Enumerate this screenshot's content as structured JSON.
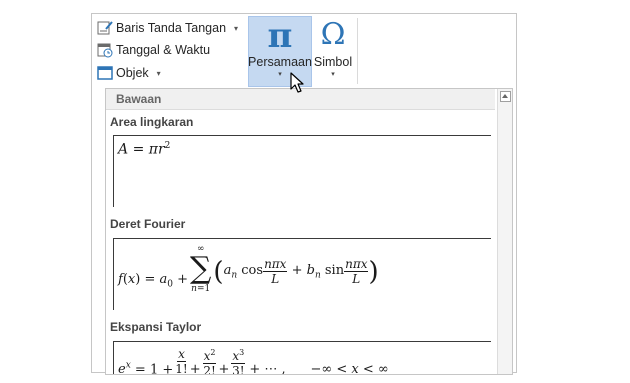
{
  "ribbon": {
    "items": [
      {
        "label": "Baris Tanda Tangan",
        "icon": "signature-line-icon",
        "caret": "▾"
      },
      {
        "label": "Tanggal & Waktu",
        "icon": "date-time-icon",
        "caret": ""
      },
      {
        "label": "Objek",
        "icon": "object-icon",
        "caret": "▾"
      }
    ],
    "equation": {
      "glyph": "π",
      "label": "Persamaan",
      "caret": "▾"
    },
    "symbol": {
      "glyph": "Ω",
      "label": "Simbol",
      "caret": "▾"
    }
  },
  "gallery": {
    "header": "Bawaan",
    "sections": [
      {
        "title": "Area lingkaran"
      },
      {
        "title": "Deret Fourier"
      },
      {
        "title": "Ekspansi Taylor"
      }
    ]
  },
  "colors": {
    "accent": "#2e75b6",
    "active_bg": "#c5d9f1"
  }
}
